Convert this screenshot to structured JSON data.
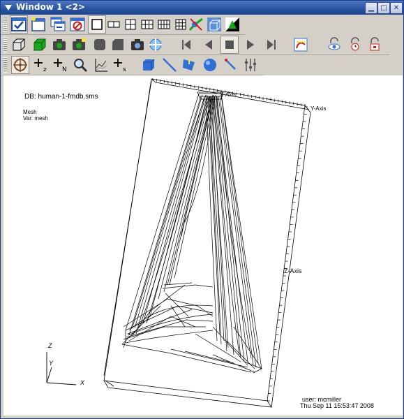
{
  "window": {
    "title": "Window 1 <2>"
  },
  "plot": {
    "db_label": "DB: human-1-fmdb.sms",
    "plot_type": "Mesh",
    "var_label": "Var: mesh",
    "x_axis_label": "X-Axis",
    "y_axis_label": "Y-Axis",
    "z_axis_label": "Z-Axis",
    "triad": {
      "z": "Z",
      "y": "Y",
      "x": "X"
    },
    "user": "user: mcmiller",
    "timestamp": "Thu Sep 11 15:53:47 2008"
  },
  "colors": {
    "title_bar": "#27539f",
    "toolbar_bg": "#d4d0c8",
    "accent_blue": "#2f6fd6",
    "accent_green": "#18a818"
  }
}
